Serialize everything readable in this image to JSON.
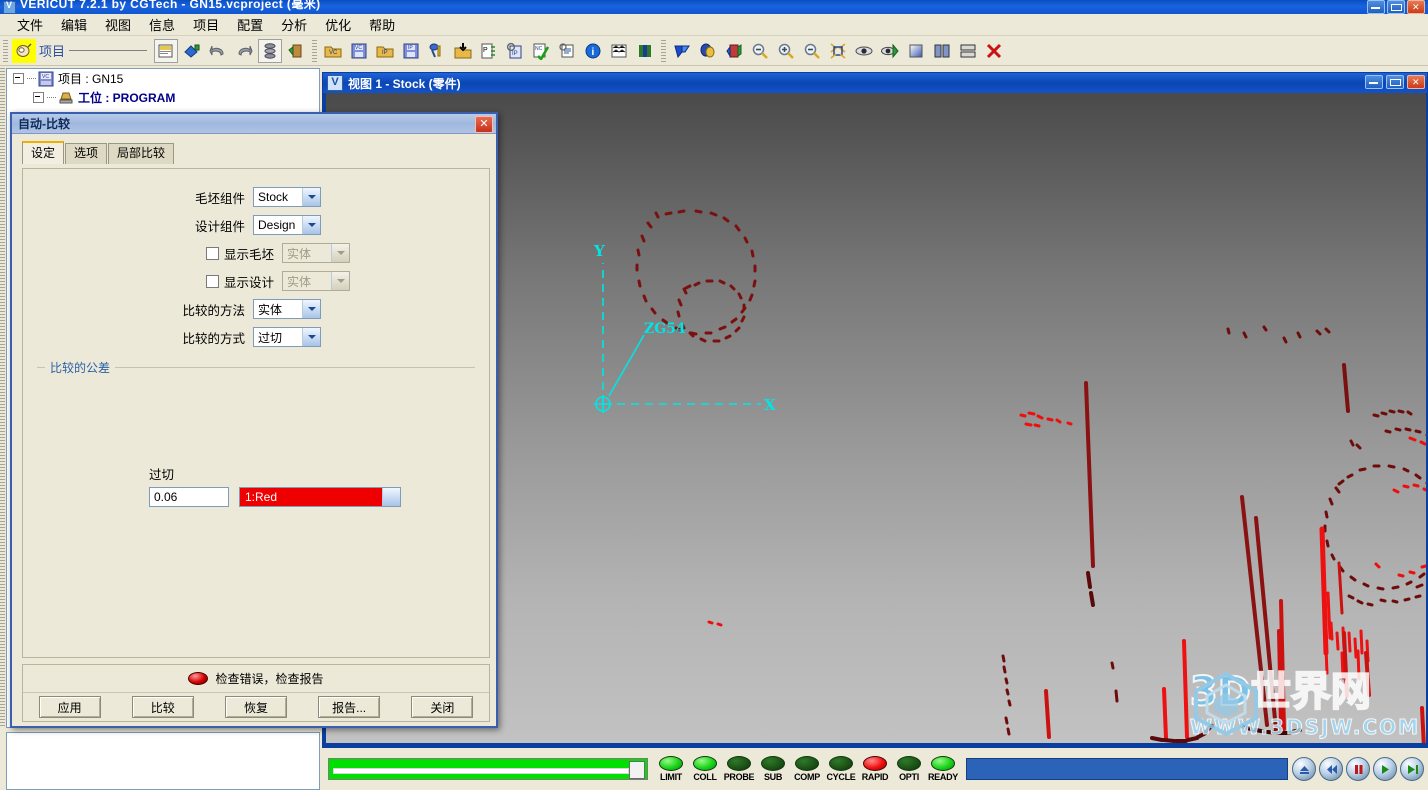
{
  "app": {
    "title": "VERICUT 7.2.1 by CGTech - GN15.vcproject (毫米)",
    "icon": "vericut-icon",
    "window_buttons": {
      "minimize": "–",
      "maximize": "□",
      "close": "✕"
    }
  },
  "menubar": {
    "items": [
      {
        "label": "文件"
      },
      {
        "label": "编辑"
      },
      {
        "label": "视图"
      },
      {
        "label": "信息"
      },
      {
        "label": "项目"
      },
      {
        "label": "配置"
      },
      {
        "label": "分析"
      },
      {
        "label": "优化"
      },
      {
        "label": "帮助"
      }
    ]
  },
  "toolbar": {
    "project_label": "项目",
    "groups": [
      {
        "icons": [
          "mouse-pointer-icon",
          "project-open-icon",
          "paint-icon",
          "undo-icon",
          "redo-icon",
          "stack-icon",
          "model-icon"
        ]
      },
      {
        "icons": [
          "open-vc-icon",
          "save-vc-icon",
          "open-ip-icon",
          "save-ip-icon",
          "tool-icon",
          "import-icon",
          "program-tree-icon",
          "inspect-ip-icon",
          "nc-check-icon",
          "log-icon",
          "info-icon",
          "autodiff-icon",
          "section-icon"
        ]
      },
      {
        "icons": [
          "compare-icon",
          "xcaliber-icon",
          "model-export-icon",
          "zoom-out-icon",
          "zoom-in-icon",
          "zoom-reset-icon",
          "fit-icon",
          "view-icon",
          "view-play-icon",
          "shade-icon",
          "split-vertical-icon",
          "split-horizontal-icon",
          "delete-icon"
        ]
      }
    ]
  },
  "project_tree": {
    "nodes": [
      {
        "label": "项目 : GN15",
        "icon": "vc-project-icon",
        "level": 1,
        "bold": false,
        "expanded": true
      },
      {
        "label": "工位 : PROGRAM",
        "icon": "setup-icon",
        "level": 2,
        "bold": true,
        "expanded": true
      }
    ]
  },
  "view_window": {
    "title": "视图 1 - Stock (零件)",
    "icon": "view-window-icon",
    "window_buttons": {
      "minimize": "–",
      "maximize": "□",
      "close": "✕"
    },
    "axis": {
      "origin_label": "ZG54",
      "x_label": "X",
      "y_label": "Y",
      "color": "#00e5e5"
    },
    "background": {
      "top": "#4a4a4a",
      "bottom": "#c2c2c2"
    },
    "watermark": {
      "main": "3D世界网",
      "sub": "WWW.3DSJW.COM"
    }
  },
  "dialog": {
    "title": "自动-比较",
    "close_label": "✕",
    "tabs": [
      {
        "label": "设定",
        "active": true
      },
      {
        "label": "选项",
        "active": false
      },
      {
        "label": "局部比较",
        "active": false
      }
    ],
    "fields": [
      {
        "label": "毛坯组件",
        "value": "Stock",
        "type": "combo",
        "disabled": false
      },
      {
        "label": "设计组件",
        "value": "Design",
        "type": "combo",
        "disabled": false
      }
    ],
    "checkbox_fields": [
      {
        "label": "显示毛坯",
        "checked": false,
        "value": "实体",
        "disabled": true
      },
      {
        "label": "显示设计",
        "checked": false,
        "value": "实体",
        "disabled": true
      }
    ],
    "method_fields": [
      {
        "label": "比较的方法",
        "value": "实体",
        "type": "combo",
        "disabled": false
      },
      {
        "label": "比较的方式",
        "value": "过切",
        "type": "combo",
        "disabled": false
      }
    ],
    "tolerance_group": {
      "legend": "比较的公差",
      "field_label": "过切",
      "value": "0.06",
      "color_value": "1:Red",
      "color_hex": "#ee0000"
    },
    "status": {
      "led_color": "#d40000",
      "text": "检查错误，检查报告"
    },
    "buttons": [
      {
        "label": "应用"
      },
      {
        "label": "比较"
      },
      {
        "label": "恢复"
      },
      {
        "label": "报告..."
      },
      {
        "label": "关闭"
      }
    ]
  },
  "statusbar": {
    "progress": {
      "value": 100,
      "color": "#00e000"
    },
    "leds": [
      {
        "label": "LIMIT",
        "state": "on"
      },
      {
        "label": "COLL",
        "state": "on"
      },
      {
        "label": "PROBE",
        "state": "off"
      },
      {
        "label": "SUB",
        "state": "off"
      },
      {
        "label": "COMP",
        "state": "off"
      },
      {
        "label": "CYCLE",
        "state": "off"
      },
      {
        "label": "RAPID",
        "state": "red"
      },
      {
        "label": "OPTI",
        "state": "off"
      },
      {
        "label": "READY",
        "state": "on"
      }
    ],
    "message": "",
    "media_buttons": [
      "eject-icon",
      "rewind-icon",
      "pause-icon",
      "play-single-icon",
      "play-icon"
    ]
  }
}
